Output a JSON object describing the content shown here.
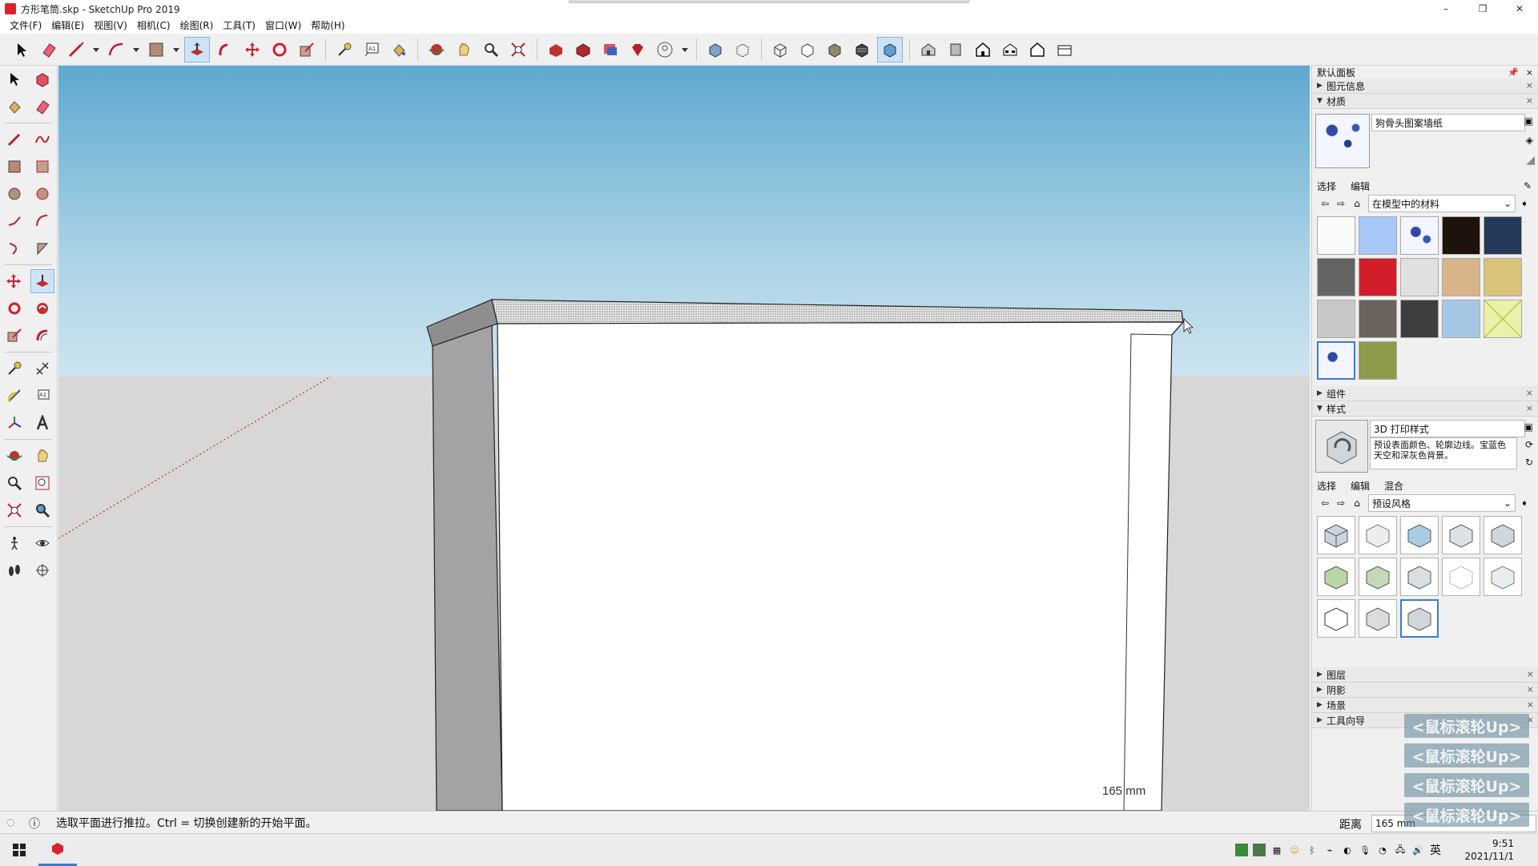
{
  "window": {
    "title": "方形笔筒.skp - SketchUp Pro 2019",
    "controls": {
      "minimize": "–",
      "maximize": "❐",
      "close": "✕"
    }
  },
  "menu": [
    "文件(F)",
    "编辑(E)",
    "视图(V)",
    "相机(C)",
    "绘图(R)",
    "工具(T)",
    "窗口(W)",
    "帮助(H)"
  ],
  "toolbar": {
    "tools": [
      "select",
      "eraser",
      "line",
      "arc",
      "rectangle",
      "push-pull",
      "follow-me",
      "move",
      "rotate",
      "scale",
      "tape-measure",
      "text",
      "paint",
      "orbit",
      "pan",
      "zoom",
      "zoom-extents",
      "warehouse",
      "extension-warehouse",
      "layout",
      "ruby",
      "user",
      "xray",
      "back-edges",
      "wireframe",
      "hidden-line",
      "shaded",
      "shaded-textures",
      "monochrome",
      "iso",
      "top",
      "front",
      "right",
      "back",
      "left"
    ]
  },
  "viewport": {
    "dimension_label": "165 mm"
  },
  "panel": {
    "title": "默认面板",
    "sections": {
      "entity_info": "图元信息",
      "materials": "材质",
      "components": "组件",
      "styles": "样式",
      "layers": "图层",
      "shadows": "阴影",
      "scenes": "场景",
      "instructor": "工具向导"
    },
    "materials": {
      "current_name": "狗骨头图案墙纸",
      "tabs": [
        "选择",
        "编辑"
      ],
      "library": "在模型中的材料",
      "swatches": [
        "#fafafa",
        "#a8c8f8",
        "pattern-blue",
        "#1e120c",
        "#253a5a",
        "#646464",
        "#d21e2a",
        "#e0e0e0",
        "#d8b48a",
        "#d9c27a",
        "#c8c8c8",
        "#6a625c",
        "#3e3e3e",
        "#a4c8e4",
        "#e8f2a8",
        "pattern-selected",
        "#8c9c4a"
      ]
    },
    "styles": {
      "current_name": "3D 打印样式",
      "description": "预设表面颜色、轮廓边线。宝蓝色天空和深灰色背景。",
      "tabs": [
        "选择",
        "编辑",
        "混合"
      ],
      "library": "预设风格",
      "thumbnail_count": 13
    }
  },
  "status": {
    "hint": "选取平面进行推拉。Ctrl = 切换创建新的开始平面。",
    "measure_label": "距离",
    "measure_value": "165 mm"
  },
  "mouse_overlays": [
    "<鼠标滚轮Up>",
    "<鼠标滚轮Up>",
    "<鼠标滚轮Up>",
    "<鼠标滚轮Up>"
  ],
  "taskbar": {
    "time": "9:51",
    "date": "2021/11/1",
    "ime": "英"
  },
  "colors": {
    "accent": "#3a7bd5",
    "sky_top": "#5fa8cf",
    "ground": "#d8d7d5",
    "sketchup_red": "#d9232d"
  }
}
